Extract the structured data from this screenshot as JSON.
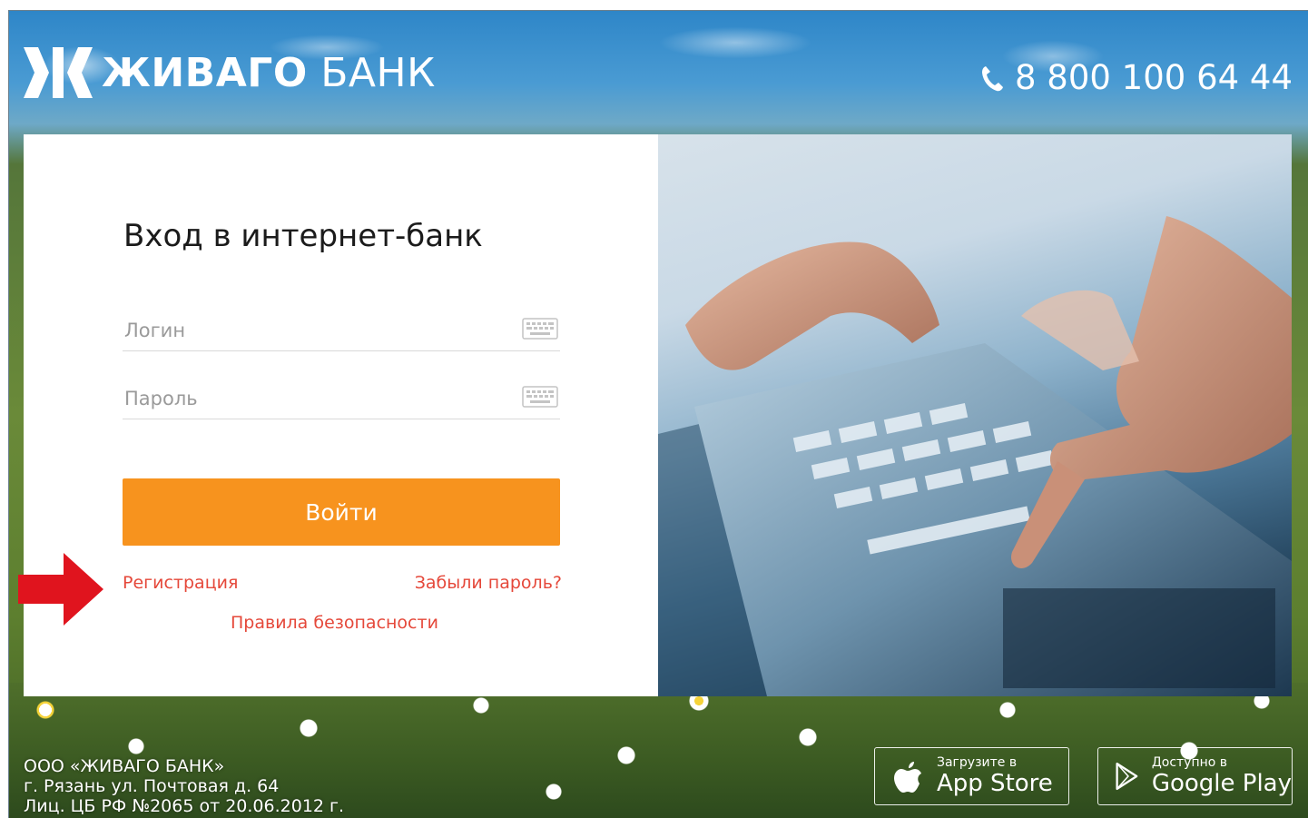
{
  "header": {
    "logo_bold": "ЖИВАГО",
    "logo_light": "БАНК",
    "phone": "8 800 100 64 44",
    "phone_icon": "phone-icon"
  },
  "login": {
    "title": "Вход в интернет-банк",
    "login_placeholder": "Логин",
    "password_placeholder": "Пароль",
    "keyboard_icon": "keyboard-icon",
    "submit_label": "Войти",
    "register_link": "Регистрация",
    "forgot_link": "Забыли пароль?",
    "security_link": "Правила безопасности"
  },
  "footer": {
    "company_name": "ООО «ЖИВАГО БАНК»",
    "address": "г. Рязань ул. Почтовая д. 64",
    "license": "Лиц. ЦБ РФ №2065 от 20.06.2012 г.",
    "appstore_small": "Загрузите в",
    "appstore_big": "App Store",
    "gplay_small": "Доступно в",
    "gplay_big": "Google Play"
  },
  "colors": {
    "accent_button": "#f7931e",
    "link": "#e5483a",
    "annotation_arrow": "#e0141e"
  }
}
